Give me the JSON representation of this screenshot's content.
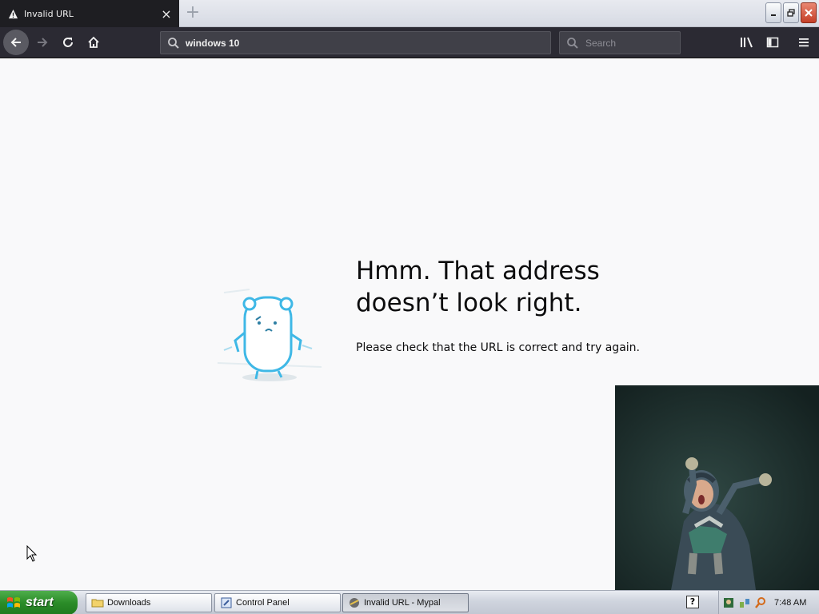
{
  "tab": {
    "title": "Invalid URL",
    "close_label": "×",
    "new_tab_label": "+"
  },
  "toolbar": {
    "url_value": "windows 10",
    "search_placeholder": "Search"
  },
  "error": {
    "title_line1": "Hmm. That address",
    "title_line2": "doesn’t look right.",
    "description": "Please check that the URL is correct and try again."
  },
  "taskbar": {
    "start_label": "start",
    "items": [
      {
        "label": "Downloads",
        "icon": "folder-icon"
      },
      {
        "label": "Control Panel",
        "icon": "control-panel-icon"
      },
      {
        "label": "Invalid URL - Mypal",
        "icon": "mypal-icon",
        "active": true
      }
    ],
    "help_label": "?",
    "clock": "7:48 AM"
  },
  "colors": {
    "tab_bg": "#1e1e22",
    "toolbar_bg": "#2b2a33",
    "content_bg": "#f9f9fa",
    "start_green": "#2b8c28"
  }
}
